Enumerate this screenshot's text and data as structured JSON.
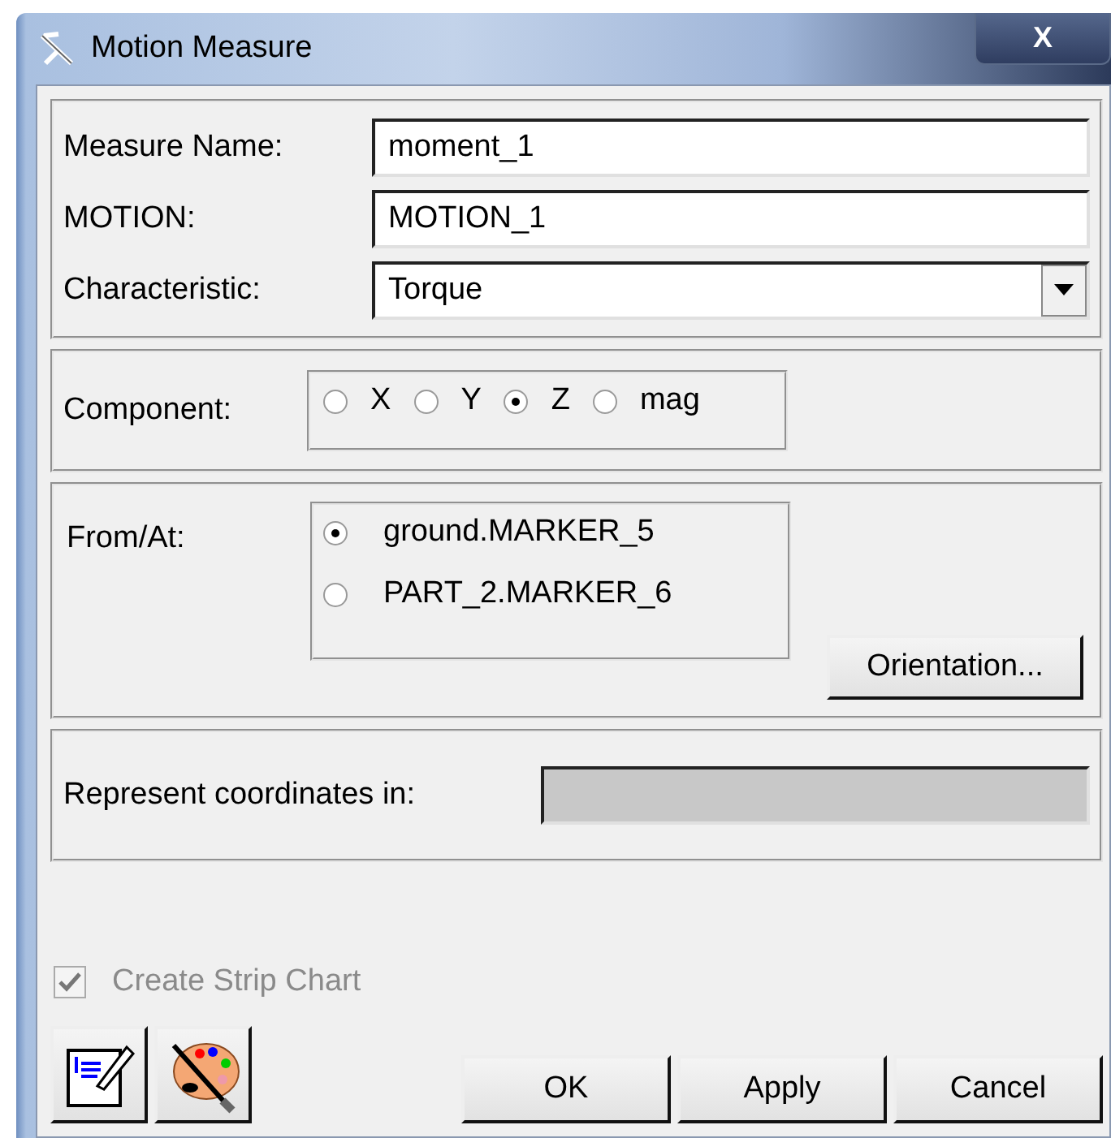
{
  "window": {
    "title": "Motion Measure",
    "close": "X"
  },
  "fields": [
    {
      "label": "Measure Name:",
      "kind": "text",
      "value": "moment_1"
    },
    {
      "label": "MOTION:",
      "kind": "text",
      "value": "MOTION_1"
    },
    {
      "label": "Characteristic:",
      "kind": "dropdown",
      "value": "Torque"
    }
  ],
  "component": {
    "label": "Component:",
    "options": [
      {
        "label": "X",
        "selected": false
      },
      {
        "label": "Y",
        "selected": false
      },
      {
        "label": "Z",
        "selected": true
      },
      {
        "label": "mag",
        "selected": false
      }
    ]
  },
  "from_at": {
    "label": "From/At:",
    "options": [
      {
        "label": "ground.MARKER_5",
        "selected": true
      },
      {
        "label": "PART_2.MARKER_6",
        "selected": false
      }
    ],
    "button": "Orientation..."
  },
  "represent": {
    "label": "Represent coordinates in:",
    "disabled": true
  },
  "strip_chart": {
    "label": "Create Strip Chart",
    "checked": true,
    "disabled": true
  },
  "buttons": [
    "OK",
    "Apply",
    "Cancel"
  ]
}
